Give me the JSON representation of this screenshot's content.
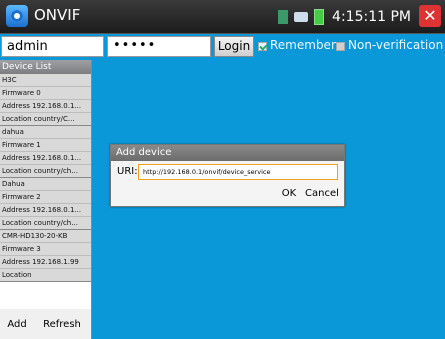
{
  "titlebar": {
    "app_title": "ONVIF",
    "app_icon": "onvif-app-icon",
    "time": "4:15:11 PM",
    "close_icon": "close-icon"
  },
  "login": {
    "username": "admin",
    "password_masked": "•••••",
    "login_label": "Login",
    "remember_label": "Remember",
    "remember_checked": true,
    "nonverification_label": "Non-verification",
    "nonverification_checked": false
  },
  "sidebar": {
    "header": "Device List",
    "devices": [
      [
        "H3C",
        "Firmware 0",
        "Address 192.168.0.1...",
        "Location country/C..."
      ],
      [
        "dahua",
        "Firmware 1",
        "Address 192.168.0.1...",
        "Location country/ch..."
      ],
      [
        "Dahua",
        "Firmware 2",
        "Address 192.168.0.1...",
        "Location country/ch..."
      ],
      [
        "CMR-HD130-20-KB",
        "Firmware 3",
        "Address 192.168.1.99",
        "Location"
      ]
    ],
    "add_label": "Add",
    "refresh_label": "Refresh"
  },
  "dialog": {
    "title": "Add device",
    "uri_label": "URI:",
    "uri_value": "http://192.168.0.1/onvif/device_service",
    "ok_label": "OK",
    "cancel_label": "Cancel"
  },
  "colors": {
    "background": "#0a98d9",
    "titlebar": "#1c1c1c",
    "close": "#dd3333"
  }
}
